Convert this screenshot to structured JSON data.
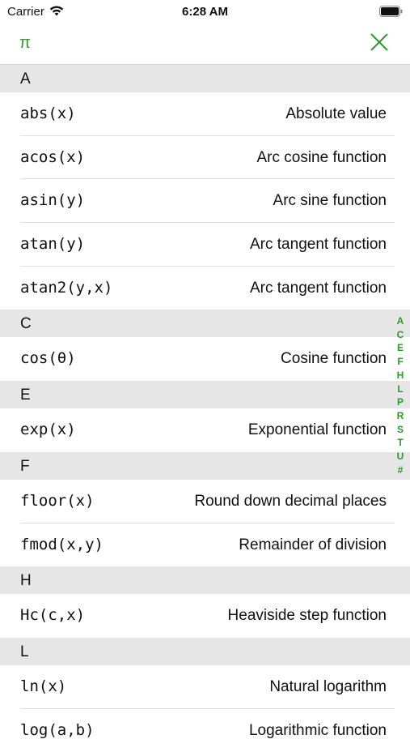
{
  "status": {
    "carrier": "Carrier",
    "time": "6:28 AM"
  },
  "nav": {
    "pi": "π"
  },
  "colors": {
    "accent": "#2e9a2e",
    "section_bg": "#e6e6e6"
  },
  "sections": [
    {
      "letter": "A",
      "rows": [
        {
          "fn": "abs(x)",
          "desc": "Absolute value"
        },
        {
          "fn": "acos(x)",
          "desc": "Arc cosine function"
        },
        {
          "fn": "asin(y)",
          "desc": "Arc sine function"
        },
        {
          "fn": "atan(y)",
          "desc": "Arc tangent function"
        },
        {
          "fn": "atan2(y,x)",
          "desc": "Arc tangent function"
        }
      ]
    },
    {
      "letter": "C",
      "rows": [
        {
          "fn": "cos(θ)",
          "desc": "Cosine function"
        }
      ]
    },
    {
      "letter": "E",
      "rows": [
        {
          "fn": "exp(x)",
          "desc": "Exponential function"
        }
      ]
    },
    {
      "letter": "F",
      "rows": [
        {
          "fn": "floor(x)",
          "desc": "Round down decimal places"
        },
        {
          "fn": "fmod(x,y)",
          "desc": "Remainder of division"
        }
      ]
    },
    {
      "letter": "H",
      "rows": [
        {
          "fn": "Hc(c,x)",
          "desc": "Heaviside step function"
        }
      ]
    },
    {
      "letter": "L",
      "rows": [
        {
          "fn": "ln(x)",
          "desc": "Natural logarithm"
        },
        {
          "fn": "log(a,b)",
          "desc": "Logarithmic function"
        }
      ]
    }
  ],
  "index_letters": [
    "A",
    "C",
    "E",
    "F",
    "H",
    "L",
    "P",
    "R",
    "S",
    "T",
    "U",
    "#"
  ]
}
